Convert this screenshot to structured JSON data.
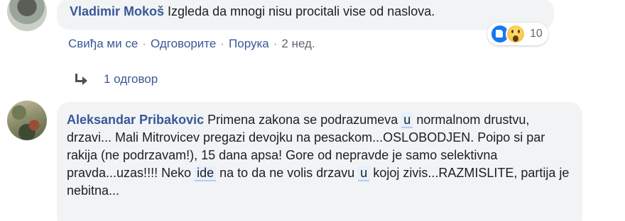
{
  "comment1": {
    "author": "Vladimir Mokoš",
    "text": "Izgleda da mnogi nisu procitali vise od naslova.",
    "reactions": {
      "icons": [
        "like-icon",
        "wow-icon"
      ],
      "count": "10"
    },
    "actions": {
      "like": "Свиђа ми се",
      "reply": "Одговорите",
      "message": "Порука",
      "time": "2 нед.",
      "separator": "·"
    },
    "replies": {
      "icon": "reply-arrow-icon",
      "label": "1 одговор"
    }
  },
  "comment2": {
    "author": "Aleksandar Pribakovic",
    "segments": [
      "Primena zakona se podrazumeva",
      "u",
      "normalnom drustvu, drzavi... Mali Mitrovicev pregazi devojku na pesackom...OSLOBODJEN. Poipo si par rakija (ne podrzavam!), 15 dana apsa! Gore od nepravde je samo selektivna pravda...uzas!!!! Neko",
      "ide",
      "na to da ne volis drzavu",
      "u",
      "kojoj zivis...RAZMISLITE, partija je nebitna..."
    ]
  }
}
